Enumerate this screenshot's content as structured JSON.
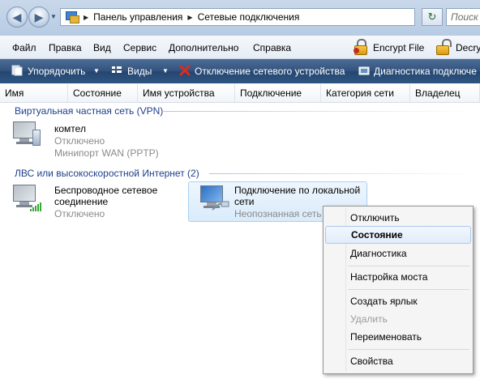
{
  "address": {
    "crumbs": [
      "Панель управления",
      "Сетевые подключения"
    ],
    "search_placeholder": "Поиск"
  },
  "menu": {
    "file": "Файл",
    "edit": "Правка",
    "view": "Вид",
    "service": "Сервис",
    "extra": "Дополнительно",
    "help": "Справка",
    "encrypt": "Encrypt File",
    "decrypt": "Decry"
  },
  "toolbar": {
    "organize": "Упорядочить",
    "views": "Виды",
    "disconnect": "Отключение сетевого устройства",
    "diagnostics": "Диагностика подключе"
  },
  "columns": [
    "Имя",
    "Состояние",
    "Имя устройства",
    "Подключение",
    "Категория сети",
    "Владелец"
  ],
  "groups": {
    "vpn": "Виртуальная частная сеть (VPN)",
    "lan": "ЛВС или высокоскоростной Интернет (2)"
  },
  "items": {
    "komtel": {
      "name": "комтел",
      "status": "Отключено",
      "device": "Минипорт WAN (PPTP)"
    },
    "wireless": {
      "name_line1": "Беспроводное сетевое",
      "name_line2": "соединение",
      "status": "Отключено"
    },
    "lan": {
      "name_line1": "Подключение по локальной",
      "name_line2": "сети",
      "status": "Неопознанная сеть"
    }
  },
  "context_menu": {
    "disable": "Отключить",
    "status": "Состояние",
    "diagnose": "Диагностика",
    "bridge": "Настройка моста",
    "shortcut": "Создать ярлык",
    "delete": "Удалить",
    "rename": "Переименовать",
    "properties": "Свойства"
  },
  "colors": {
    "group_header": "#1e3f8a",
    "toolbar_bg": "#2f5683",
    "selection": "#d9ebfb"
  }
}
